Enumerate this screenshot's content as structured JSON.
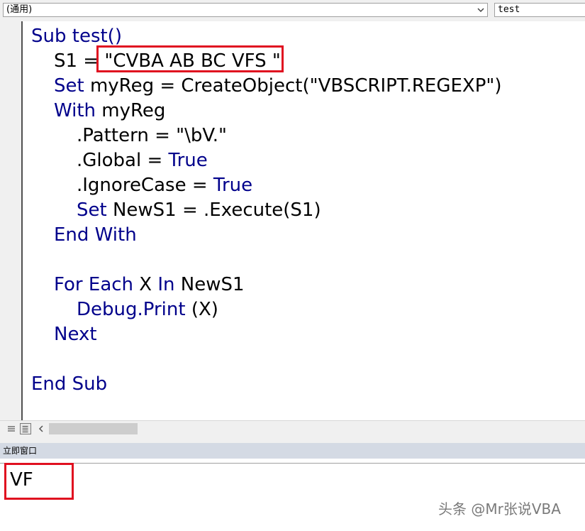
{
  "toolbar": {
    "object_dropdown": "(通用)",
    "procedure_dropdown": "test"
  },
  "code": {
    "lines": [
      "Sub test()",
      "S1 = ",
      "\"CVBA AB BC VFS \"",
      "Set",
      " myReg = CreateObject(\"VBSCRIPT.REGEXP\")",
      "With",
      " myReg",
      ".Pattern = \"\\bV.\"",
      ".Global = ",
      "True",
      ".IgnoreCase = ",
      "True",
      "Set",
      " NewS1 = .Execute(S1)",
      "End With",
      "For Each",
      " X ",
      "In",
      " NewS1",
      "Debug.Print",
      " (X)",
      "Next",
      "End Sub"
    ]
  },
  "immediate": {
    "title": "立即窗口",
    "output": "VF"
  },
  "watermark": "头条 @Mr张说VBA",
  "colors": {
    "keyword": "#00008b",
    "highlight_box": "#e01020"
  },
  "icons": {
    "dropdown": "chevron-down-icon",
    "procedure_view": "procedure-view-icon",
    "full_module_view": "full-module-view-icon",
    "scroll_left": "chevron-left-icon"
  }
}
